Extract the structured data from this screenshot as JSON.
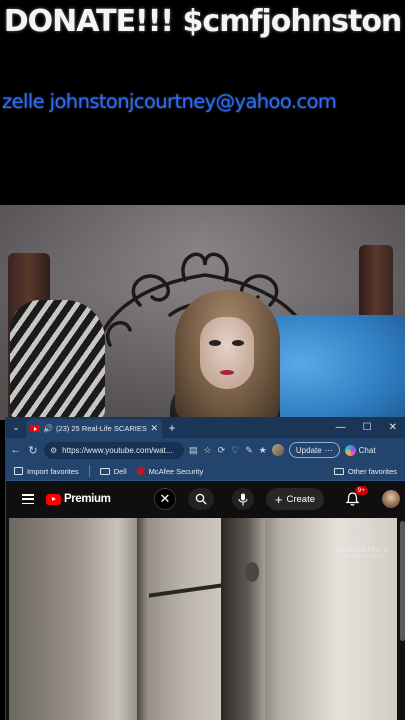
{
  "overlay": {
    "donate_text": "DONATE!!! $cmfjohnston",
    "zelle_text": "zelle johnstonjcourtney@yahoo.com"
  },
  "browser": {
    "tab": {
      "title": "(23) 25 Real-Life SCARIEST Gh",
      "close": "✕"
    },
    "new_tab": "+",
    "window_controls": {
      "minimize": "—",
      "maximize": "☐",
      "close": "✕"
    },
    "address": {
      "url": "https://www.youtube.com/wat...",
      "update_label": "Update",
      "chat_label": "Chat"
    },
    "bookmarks": [
      {
        "label": "Import favorites"
      },
      {
        "label": "Dell"
      },
      {
        "label": "McAfee Security"
      }
    ],
    "other_favorites": "Other favorites"
  },
  "youtube": {
    "logo_label": "Premium",
    "create_label": "Create",
    "notification_count": "9+",
    "watermark_line1": "GRANDMA'S",
    "watermark_line2": "NIGHTMARES"
  },
  "colors": {
    "zelle_blue": "#2f6df0",
    "youtube_red": "#ff0000",
    "browser_chrome": "#23456d"
  },
  "icons": [
    "chevron-down-icon",
    "speaker-icon",
    "back-icon",
    "refresh-icon",
    "star-icon",
    "search-icon",
    "mic-icon",
    "bell-icon",
    "menu-icon",
    "close-icon"
  ]
}
